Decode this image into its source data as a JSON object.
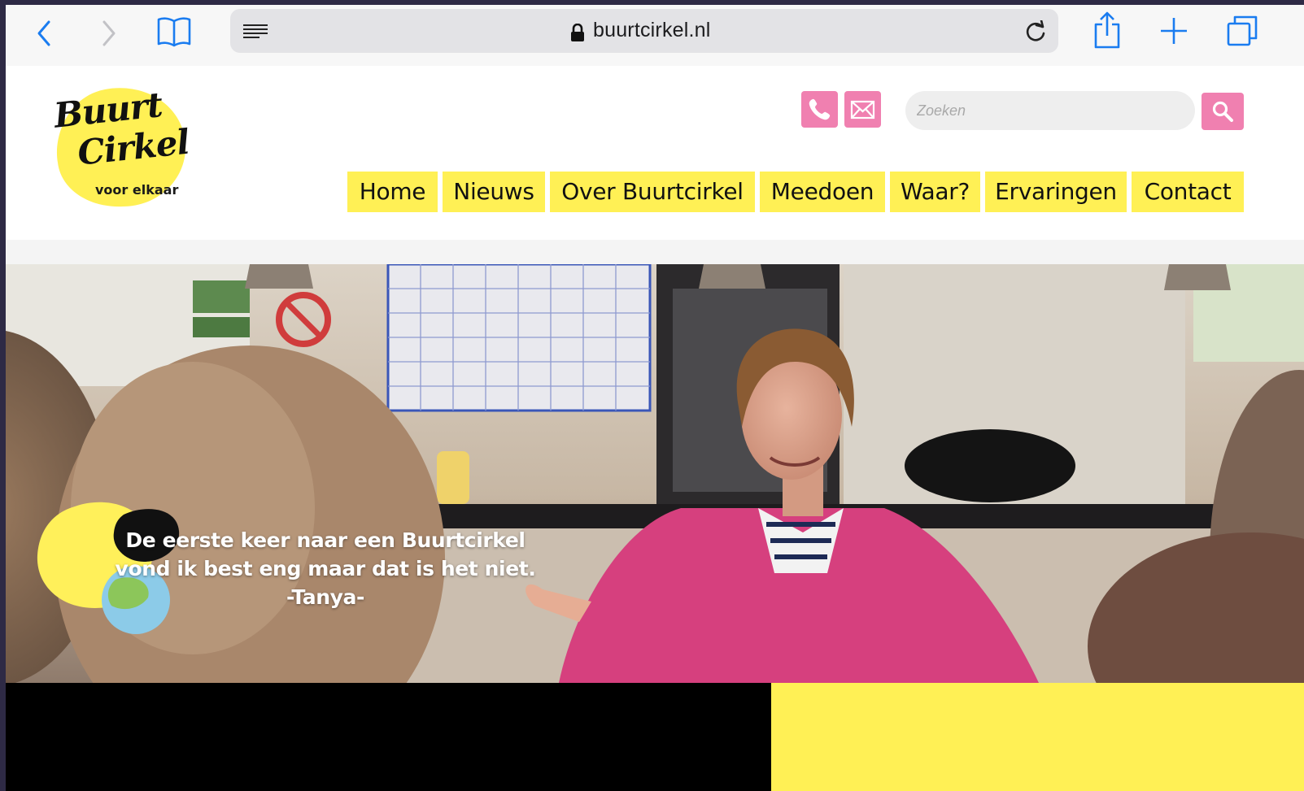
{
  "browser": {
    "url": "buurtcirkel.nl"
  },
  "site": {
    "logo": {
      "line1": "Buurt",
      "line2": "Cirkel",
      "tagline": "voor elkaar"
    },
    "search": {
      "placeholder": "Zoeken"
    },
    "nav": [
      {
        "label": "Home"
      },
      {
        "label": "Nieuws"
      },
      {
        "label": "Over Buurtcirkel"
      },
      {
        "label": "Meedoen"
      },
      {
        "label": "Waar?"
      },
      {
        "label": "Ervaringen"
      },
      {
        "label": "Contact"
      }
    ]
  },
  "hero": {
    "quote_line1": "De eerste keer naar een Buurtcirkel",
    "quote_line2": "vond ik best eng maar dat is het niet.",
    "attribution": "-Tanya-"
  },
  "colors": {
    "brand_yellow": "#fff055",
    "brand_pink": "#f080b0",
    "black": "#000000"
  }
}
